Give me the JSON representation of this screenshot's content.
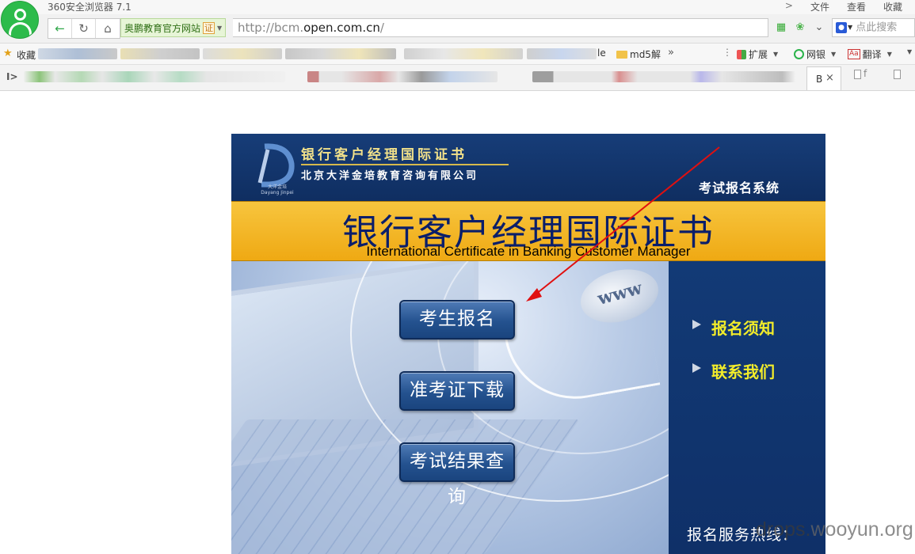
{
  "browser": {
    "app_title": "360安全浏览器 7.1",
    "menu": [
      "文件",
      "查看",
      "收藏"
    ],
    "site_badge": "奥鹏教育官方网站",
    "cert_label": "证",
    "url_prefix": "http://bcm.",
    "url_host": "open.com.cn",
    "url_suffix": "/",
    "search_placeholder": "点此搜索",
    "favorites_label": "收藏",
    "fav_partial_text": "le",
    "fav_md5": "md5解",
    "tools": {
      "extensions": "扩展",
      "bank": "网银",
      "translate": "翻译"
    },
    "active_tab_text": "B",
    "inactive_tab_text": "f",
    "tab_toggle": "I>"
  },
  "page": {
    "logo_small": "大洋金培",
    "logo_tagline": "Dayang Jinpei",
    "logo_title": "银行客户经理国际证书",
    "company": "北京大洋金培教育咨询有限公司",
    "system_name": "考试报名系统",
    "banner_cn": "银行客户经理国际证书",
    "banner_en": "International Certificate in Banking Customer Manager",
    "www": "www",
    "buttons": {
      "register": "考生报名",
      "admission_download": "准考证下载",
      "result_query": "考试结果查询"
    },
    "side_links": {
      "notice": "报名须知",
      "contact": "联系我们"
    },
    "hotline": "报名服务热线："
  },
  "watermark": {
    "text_a": "drops.",
    "text_b": "wooyun.org"
  },
  "colors": {
    "header_navy": "#173d78",
    "banner_gold": "#f3b627",
    "side_link_yellow": "#f2ec2a",
    "arrow_red": "#e01010"
  }
}
